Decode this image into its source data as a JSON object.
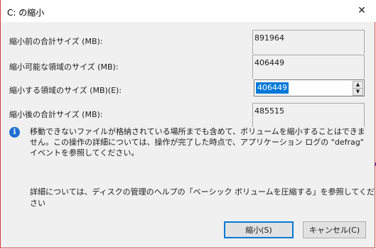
{
  "window": {
    "title": "C: の縮小",
    "close_glyph": "✕"
  },
  "rows": [
    {
      "label": "縮小前の合計サイズ (MB):",
      "value": "891964"
    },
    {
      "label": "縮小可能な領域のサイズ (MB):",
      "value": "406449"
    },
    {
      "label": "縮小する領域のサイズ (MB)(E):",
      "value": "406449"
    },
    {
      "label": "縮小後の合計サイズ (MB):",
      "value": "485515"
    }
  ],
  "info": {
    "icon": "i",
    "text": "移動できないファイルが格納されている場所までも含めて、ボリュームを縮小することはできません。この操作の詳細については、操作が完了した時点で、アプリケーション ログの \"defrag\" イベントを参照してください。"
  },
  "help": {
    "text": "詳細については、ディスクの管理のヘルプの「ベーシック ボリュームを圧縮する」を参照してください"
  },
  "buttons": {
    "shrink": "縮小(S)",
    "cancel": "キャンセル(C)"
  },
  "spinner": {
    "up_glyph": "▲",
    "down_glyph": "▼"
  },
  "colors": {
    "accent": "#0078d7",
    "window_border": "#d23b3b",
    "info_icon": "#1f6fd1"
  }
}
